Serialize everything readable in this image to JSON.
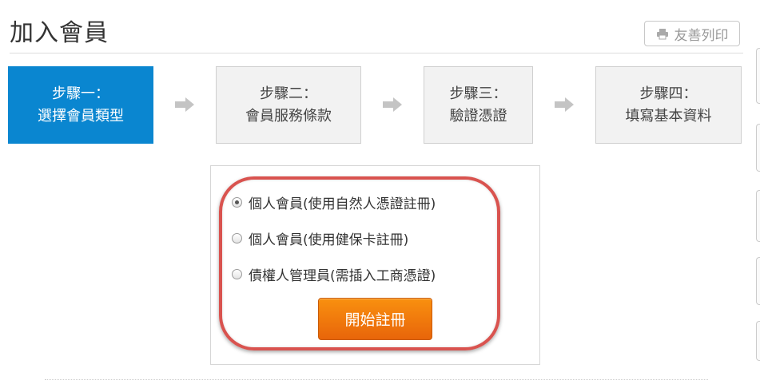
{
  "page": {
    "title": "加入會員",
    "print_label": "友善列印"
  },
  "steps": [
    {
      "line1": "步驟一：",
      "line2": "選擇會員類型",
      "active": true
    },
    {
      "line1": "步驟二：",
      "line2": "會員服務條款",
      "active": false
    },
    {
      "line1": "步驟三：",
      "line2": "驗證憑證",
      "active": false
    },
    {
      "line1": "步驟四：",
      "line2": "填寫基本資料",
      "active": false
    }
  ],
  "member_types": {
    "options": [
      {
        "label": "個人會員(使用自然人憑證註冊)",
        "selected": true
      },
      {
        "label": "個人會員(使用健保卡註冊)",
        "selected": false
      },
      {
        "label": "債權人管理員(需插入工商憑證)",
        "selected": false
      }
    ],
    "start_label": "開始註冊"
  },
  "icons": {
    "print": "printer-icon",
    "step_arrow": "arrow-right-icon"
  },
  "colors": {
    "active_step": "#0a86d0",
    "start_button": "#f07d0c",
    "highlight": "#d9534f"
  }
}
